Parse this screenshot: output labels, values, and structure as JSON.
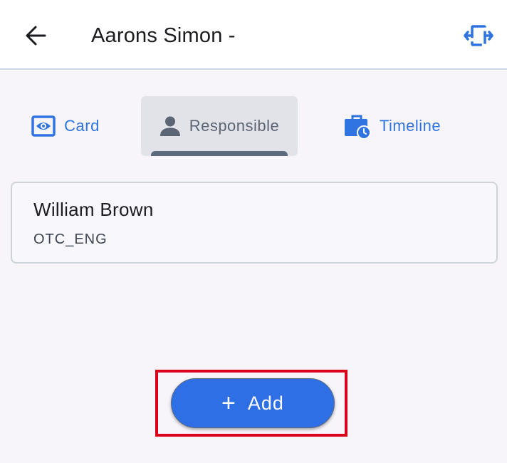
{
  "header": {
    "title": "Aarons Simon -",
    "back_icon": "arrow-left-icon",
    "expand_icon": "expand-horizontal-icon"
  },
  "tabs": [
    {
      "label": "Card",
      "icon": "eye-card-icon",
      "selected": false
    },
    {
      "label": "Responsible",
      "icon": "person-icon",
      "selected": true
    },
    {
      "label": "Timeline",
      "icon": "briefcase-clock-icon",
      "selected": false
    }
  ],
  "responsible": {
    "name": "William Brown",
    "group": "OTC_ENG"
  },
  "add_button": {
    "icon": "plus",
    "label": "Add"
  },
  "colors": {
    "accent": "#2f74e0",
    "button": "#2f6fe5",
    "highlight": "#d9001b",
    "background": "#f7f5fa"
  }
}
